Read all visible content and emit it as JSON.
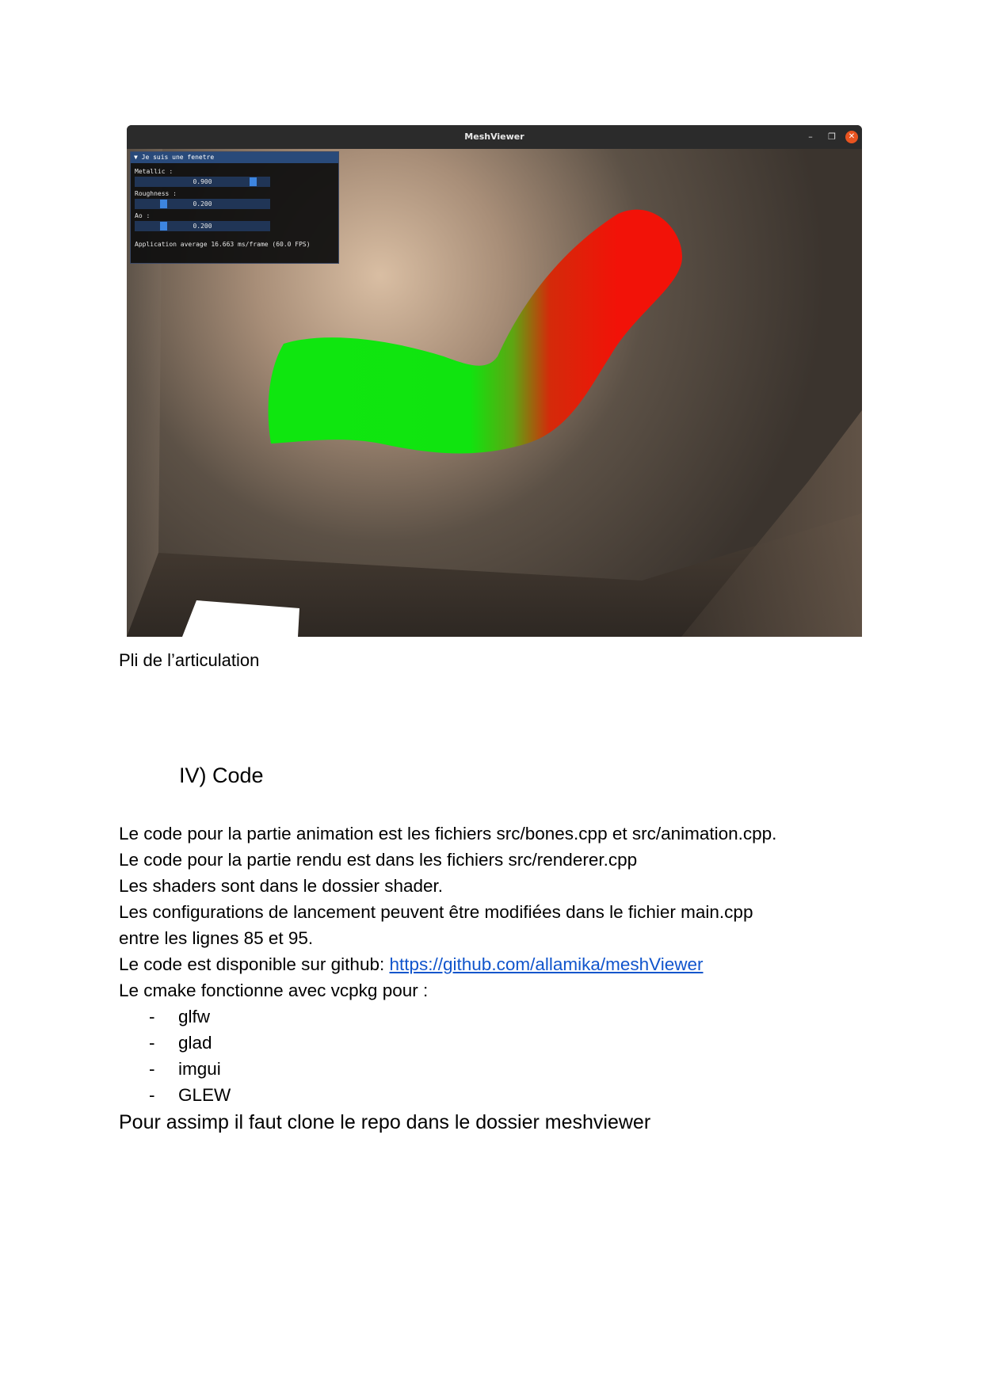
{
  "window": {
    "title": "MeshViewer",
    "minimize_glyph": "–",
    "maximize_glyph": "❐",
    "close_glyph": "✕"
  },
  "imgui_panel": {
    "header": "▼ Je suis une fenetre",
    "sliders": [
      {
        "label": "Metallic :",
        "value_text": "0.900",
        "value": 0.9
      },
      {
        "label": "Roughness :",
        "value_text": "0.200",
        "value": 0.2
      },
      {
        "label": "Ao :",
        "value_text": "0.200",
        "value": 0.2
      }
    ],
    "fps_text": "Application average 16.663 ms/frame (60.0 FPS)"
  },
  "scene": {
    "mesh_colors": [
      "#0fe60f",
      "#f21208"
    ]
  },
  "document": {
    "caption": "Pli de l’articulation",
    "section_heading": "IV) Code",
    "paragraphs": [
      "Le code pour la partie animation est les fichiers src/bones.cpp et src/animation.cpp.",
      "Le code pour la partie rendu est dans les fichiers src/renderer.cpp",
      "Les shaders sont dans le dossier shader.",
      "Les configurations de lancement peuvent être modifiées dans le fichier main.cpp",
      "entre les lignes 85 et 95."
    ],
    "github_prefix": "Le code est disponible sur github: ",
    "github_url": "https://github.com/allamika/meshViewer",
    "cmake_intro": "Le cmake fonctionne avec vcpkg pour :",
    "dependencies": [
      "glfw",
      "glad",
      "imgui",
      "GLEW"
    ],
    "closing": "Pour assimp il faut clone le repo dans le dossier meshviewer"
  }
}
